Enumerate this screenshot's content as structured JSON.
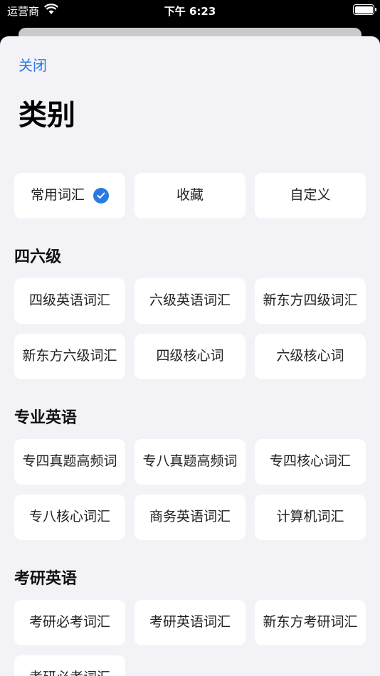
{
  "status": {
    "carrier": "运营商",
    "time": "下午 6:23"
  },
  "header": {
    "close_label": "关闭",
    "title": "类别"
  },
  "top": [
    {
      "label": "常用词汇",
      "selected": true
    },
    {
      "label": "收藏"
    },
    {
      "label": "自定义"
    }
  ],
  "sections": [
    {
      "title": "四六级",
      "items": [
        "四级英语词汇",
        "六级英语词汇",
        "新东方四级词汇",
        "新东方六级词汇",
        "四级核心词",
        "六级核心词"
      ]
    },
    {
      "title": "专业英语",
      "items": [
        "专四真题高频词",
        "专八真题高频词",
        "专四核心词汇",
        "专八核心词汇",
        "商务英语词汇",
        "计算机词汇"
      ]
    },
    {
      "title": "考研英语",
      "items": [
        "考研必考词汇",
        "考研英语词汇",
        "新东方考研词汇",
        "考研必考词汇"
      ]
    }
  ],
  "colors": {
    "accent": "#2a7ae2",
    "background": "#f2f2f7"
  }
}
